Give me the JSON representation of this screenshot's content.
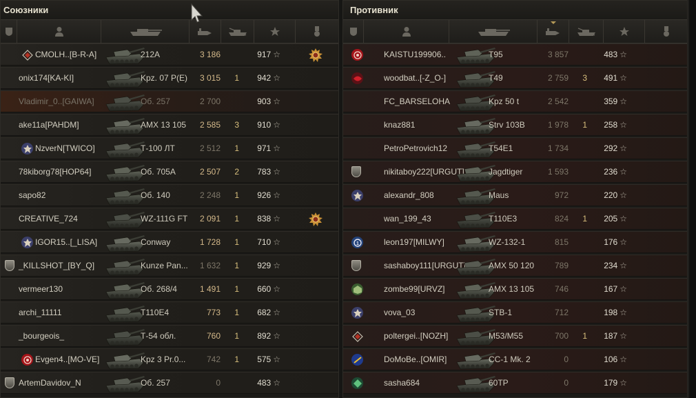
{
  "allies": {
    "title": "Союзники",
    "rows": [
      {
        "player": "СМОLH..[B-R-A]",
        "vehicle": "212А",
        "damage": "3 186",
        "kills": "",
        "xp": "917",
        "badge": "clan-diamond",
        "medal": true,
        "dead": false
      },
      {
        "player": "onix174[KA-KI]",
        "vehicle": "Kpz. 07 P(E)",
        "damage": "3 015",
        "kills": "1",
        "xp": "942",
        "badge": "",
        "medal": false,
        "dead": false
      },
      {
        "player": "Vladimir_0..[GAIWA]",
        "vehicle": "Об. 257",
        "damage": "2 700",
        "kills": "",
        "xp": "903",
        "badge": "",
        "medal": false,
        "dead": true
      },
      {
        "player": "ake11a[PAHDM]",
        "vehicle": "AMX 13 105",
        "damage": "2 585",
        "kills": "3",
        "xp": "910",
        "badge": "",
        "medal": false,
        "dead": false
      },
      {
        "player": "NzverN[TWICO]",
        "vehicle": "Т-100 ЛТ",
        "damage": "2 512",
        "kills": "1",
        "xp": "971",
        "badge": "clan-emblem",
        "medal": false,
        "dead": false
      },
      {
        "player": "78kiborg78[HOP64]",
        "vehicle": "Об. 705А",
        "damage": "2 507",
        "kills": "2",
        "xp": "783",
        "badge": "",
        "medal": false,
        "dead": false
      },
      {
        "player": "sapo82",
        "vehicle": "Об. 140",
        "damage": "2 248",
        "kills": "1",
        "xp": "926",
        "badge": "",
        "medal": false,
        "dead": false
      },
      {
        "player": "CREATIVE_724",
        "vehicle": "WZ-111G FT",
        "damage": "2 091",
        "kills": "1",
        "xp": "838",
        "badge": "",
        "medal": true,
        "dead": false
      },
      {
        "player": "IGOR15..[_LISA]",
        "vehicle": "Conway",
        "damage": "1 728",
        "kills": "1",
        "xp": "710",
        "badge": "clan-emblem",
        "medal": false,
        "dead": false
      },
      {
        "player": "_KILLSHOT_[BY_Q]",
        "vehicle": "Kunze Pan...",
        "damage": "1 632",
        "kills": "1",
        "xp": "929",
        "badge": "rank",
        "medal": false,
        "dead": false
      },
      {
        "player": "vermeer130",
        "vehicle": "Об. 268/4",
        "damage": "1 491",
        "kills": "1",
        "xp": "660",
        "badge": "",
        "medal": false,
        "dead": false
      },
      {
        "player": "archi_11111",
        "vehicle": "T110E4",
        "damage": "773",
        "kills": "1",
        "xp": "682",
        "badge": "",
        "medal": false,
        "dead": false
      },
      {
        "player": "_bourgeois_",
        "vehicle": "Т-54 обл.",
        "damage": "760",
        "kills": "1",
        "xp": "892",
        "badge": "",
        "medal": false,
        "dead": false
      },
      {
        "player": "Evgen4..[MO-VE]",
        "vehicle": "Kpz 3 Pr.0...",
        "damage": "742",
        "kills": "1",
        "xp": "575",
        "badge": "clan-red",
        "medal": false,
        "dead": false
      },
      {
        "player": "ArtemDavidov_N",
        "vehicle": "Об. 257",
        "damage": "0",
        "kills": "",
        "xp": "483",
        "badge": "rank",
        "medal": false,
        "dead": false
      }
    ]
  },
  "enemies": {
    "title": "Противник",
    "rows": [
      {
        "player": "KAISTU199906..",
        "vehicle": "T95",
        "damage": "3 857",
        "kills": "",
        "xp": "483",
        "badge": "clan-red"
      },
      {
        "player": "woodbat..[-Z_O-]",
        "vehicle": "T49",
        "damage": "2 759",
        "kills": "3",
        "xp": "491",
        "badge": "clan-red2"
      },
      {
        "player": "FC_BARSELOHA",
        "vehicle": "Kpz 50 t",
        "damage": "2 542",
        "kills": "",
        "xp": "359",
        "badge": ""
      },
      {
        "player": "knaz881",
        "vehicle": "Strv 103B",
        "damage": "1 978",
        "kills": "1",
        "xp": "258",
        "badge": ""
      },
      {
        "player": "PetroPetrovich12",
        "vehicle": "T54E1",
        "damage": "1 734",
        "kills": "",
        "xp": "292",
        "badge": ""
      },
      {
        "player": "nikitaboy222[URGUT]",
        "vehicle": "Jagdtiger",
        "damage": "1 593",
        "kills": "",
        "xp": "236",
        "badge": "rank"
      },
      {
        "player": "alexandr_808",
        "vehicle": "Maus",
        "damage": "972",
        "kills": "",
        "xp": "220",
        "badge": "clan-emblem"
      },
      {
        "player": "wan_199_43",
        "vehicle": "T110E3",
        "damage": "824",
        "kills": "1",
        "xp": "205",
        "badge": ""
      },
      {
        "player": "leon197[MILWY]",
        "vehicle": "WZ-132-1",
        "damage": "815",
        "kills": "",
        "xp": "176",
        "badge": "clan-blue"
      },
      {
        "player": "sashaboy111[URGUT]",
        "vehicle": "AMX 50 120",
        "damage": "789",
        "kills": "",
        "xp": "234",
        "badge": "rank"
      },
      {
        "player": "zombe99[URVZ]",
        "vehicle": "AMX 13 105",
        "damage": "746",
        "kills": "",
        "xp": "167",
        "badge": "clan-green"
      },
      {
        "player": "vova_03",
        "vehicle": "STB-1",
        "damage": "712",
        "kills": "",
        "xp": "198",
        "badge": "clan-emblem"
      },
      {
        "player": "poltergei..[NOZH]",
        "vehicle": "M53/M55",
        "damage": "700",
        "kills": "1",
        "xp": "187",
        "badge": "clan-diamond"
      },
      {
        "player": "DoMoBe..[OMIR]",
        "vehicle": "CC-1 Mk. 2",
        "damage": "0",
        "kills": "",
        "xp": "106",
        "badge": "clan-blue2"
      },
      {
        "player": "sasha684",
        "vehicle": "60TP",
        "damage": "0",
        "kills": "",
        "xp": "179",
        "badge": "clan-green2"
      }
    ]
  },
  "icons": {
    "rank_column": "rank-shield-icon",
    "player_column": "player-silhouette-icon",
    "tank_column": "tank-silhouette-icon",
    "damage_column": "damage-shell-icon",
    "kills_column": "destroyed-tank-icon",
    "xp_column": "experience-star-icon",
    "medal_column": "medal-icon"
  },
  "colors": {
    "damage": "#d4b98a",
    "kills": "#d8bf7d",
    "dead_row": "#3a2216"
  }
}
